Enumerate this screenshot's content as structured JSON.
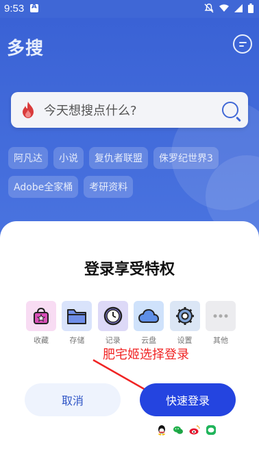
{
  "status_bar": {
    "time": "9:53"
  },
  "header": {
    "logo": "多搜"
  },
  "search": {
    "placeholder": "今天想搜点什么?"
  },
  "hot_tags": [
    "阿凡达",
    "小说",
    "复仇者联盟",
    "侏罗纪世界3",
    "Adobe全家桶",
    "考研资料"
  ],
  "login_sheet": {
    "title": "登录享受特权",
    "perks": [
      {
        "label": "收藏",
        "icon": "bag-star-icon",
        "bg": "#f8dcf3"
      },
      {
        "label": "存储",
        "icon": "folder-icon",
        "bg": "#d9e3fb"
      },
      {
        "label": "记录",
        "icon": "clock-icon",
        "bg": "#ddd9f7"
      },
      {
        "label": "云盘",
        "icon": "cloud-icon",
        "bg": "#cfe2fb"
      },
      {
        "label": "设置",
        "icon": "gear-icon",
        "bg": "#dbe6f5"
      },
      {
        "label": "其他",
        "icon": "more-icon",
        "bg": "#ececef"
      }
    ],
    "annotation": "肥宅姬选择登录",
    "cancel_label": "取消",
    "login_label": "快速登录"
  },
  "colors": {
    "brand_blue": "#3f67d6",
    "login_button": "#2444e0",
    "annotation_red": "#f02424"
  }
}
